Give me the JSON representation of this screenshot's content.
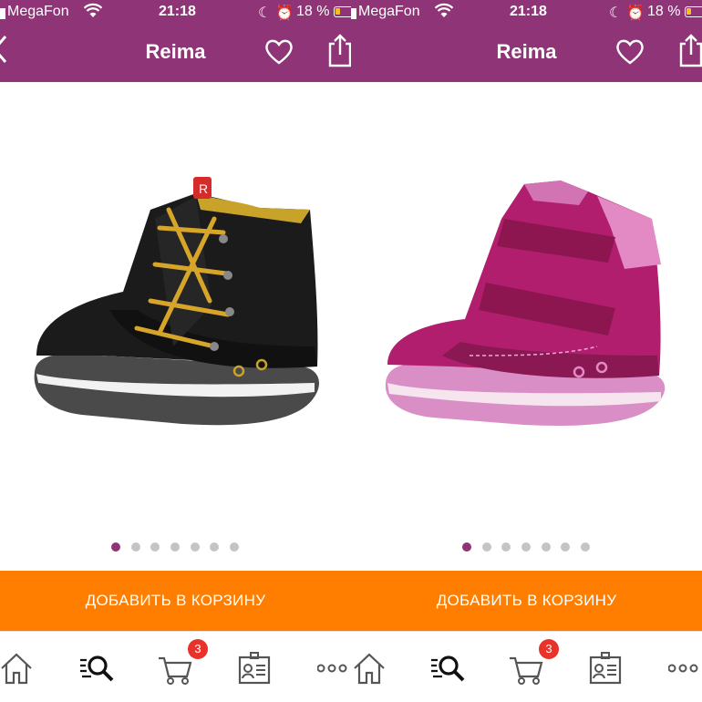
{
  "panels": [
    {
      "status": {
        "carrier": "MegaFon",
        "time": "21:18",
        "battery": "18 %"
      },
      "header": {
        "title": "Reima"
      },
      "product": {
        "image_name": "black-sneaker-boot",
        "dots_total": 7,
        "dot_active": 0
      },
      "cart_button": {
        "label": "ДОБАВИТЬ В КОРЗИНУ"
      },
      "tabbar": {
        "cart_badge": "3"
      }
    },
    {
      "status": {
        "carrier": "MegaFon",
        "time": "21:18",
        "battery": "18 %"
      },
      "header": {
        "title": "Reima"
      },
      "product": {
        "image_name": "pink-velcro-boot",
        "dots_total": 7,
        "dot_active": 0
      },
      "cart_button": {
        "label": "ДОБАВИТЬ В КОРЗИНУ"
      },
      "tabbar": {
        "cart_badge": "3"
      }
    }
  ],
  "colors": {
    "header": "#8f3476",
    "cta": "#ff7e00",
    "badge": "#e8332a",
    "active_dot": "#8f3476"
  },
  "icons": [
    "back-icon",
    "heart-icon",
    "share-icon",
    "home-icon",
    "search-icon",
    "cart-icon",
    "profile-card-icon",
    "more-icon"
  ]
}
